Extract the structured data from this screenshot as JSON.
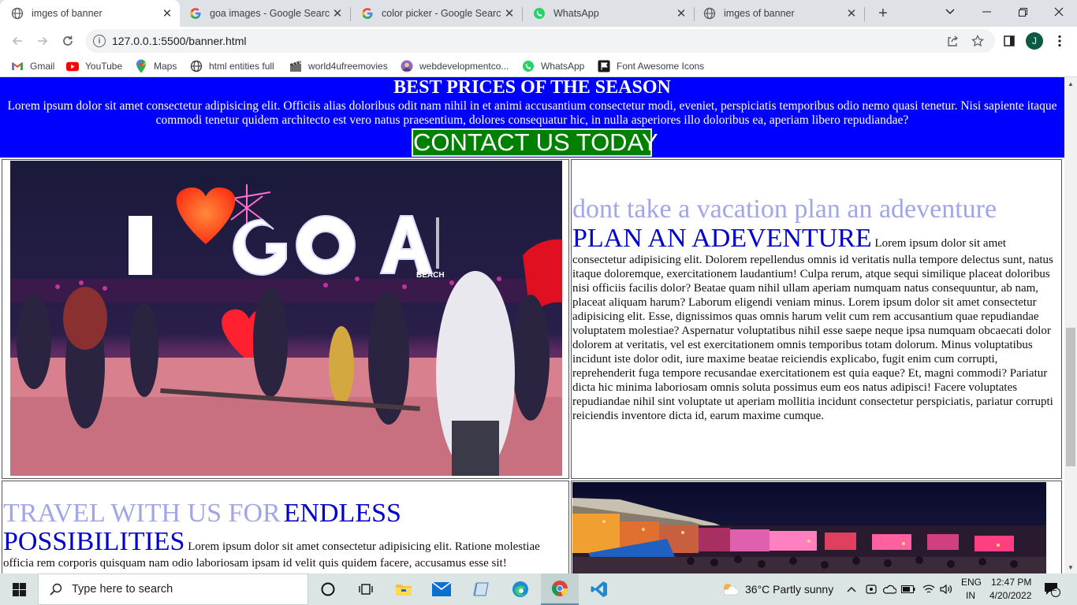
{
  "browser": {
    "tabs": [
      {
        "title": "imges of banner",
        "icon": "globe-icon",
        "active": true
      },
      {
        "title": "goa images - Google Search",
        "icon": "google-icon",
        "active": false
      },
      {
        "title": "color picker - Google Search",
        "icon": "google-icon",
        "active": false
      },
      {
        "title": "WhatsApp",
        "icon": "whatsapp-icon",
        "active": false
      },
      {
        "title": "imges of banner",
        "icon": "globe-icon",
        "active": false
      }
    ],
    "url": "127.0.0.1:5500/banner.html",
    "profile_initial": "J",
    "bookmarks": [
      {
        "label": "Gmail",
        "icon": "gmail-icon"
      },
      {
        "label": "YouTube",
        "icon": "youtube-icon"
      },
      {
        "label": "Maps",
        "icon": "maps-icon"
      },
      {
        "label": "html entities full",
        "icon": "globe-icon"
      },
      {
        "label": "world4ufreemovies",
        "icon": "movie-icon"
      },
      {
        "label": "webdevelopmentco...",
        "icon": "avatar-icon"
      },
      {
        "label": "WhatsApp",
        "icon": "whatsapp-icon"
      },
      {
        "label": "Font Awesome Icons",
        "icon": "flag-icon"
      }
    ]
  },
  "page": {
    "banner": {
      "heading": "BEST PRICES OF THE SEASON",
      "text": "Lorem ipsum dolor sit amet consectetur adipisicing elit. Officiis alias doloribus odit nam nihil in et animi accusantium consectetur modi, eveniet, perspiciatis temporibus odio nemo quasi tenetur. Nisi sapiente itaque commodi tenetur quidem architecto est vero natus praesentium, dolores consequatur hic, in nulla asperiores illo doloribus ea, aperiam libero repudiandae?",
      "button": "CONTACT US TODAY"
    },
    "section1": {
      "subtitle": "dont take a vacation plan an adeventure",
      "title": "PLAN AN ADEVENTURE",
      "text": "Lorem ipsum dolor sit amet consectetur adipisicing elit. Dolorem repellendus omnis id veritatis nulla tempore delectus sunt, natus itaque doloremque, exercitationem laudantium! Culpa rerum, atque sequi similique placeat doloribus nisi officiis facilis dolor? Beatae quam nihil ullam aperiam numquam natus consequuntur, ab nam, placeat aliquam harum? Laborum eligendi veniam minus. Lorem ipsum dolor sit amet consectetur adipisicing elit. Esse, dignissimos quas omnis harum velit cum rem accusantium quae repudiandae voluptatem molestiae? Aspernatur voluptatibus nihil esse saepe neque ipsa numquam obcaecati dolor dolorem at veritatis, vel est exercitationem omnis temporibus totam dolorum. Minus voluptatibus incidunt iste dolor odit, iure maxime beatae reiciendis explicabo, fugit enim cum corrupti, reprehenderit fuga tempore recusandae exercitationem est quia eaque? Et, magni commodi? Pariatur dicta hic minima laboriosam omnis soluta possimus eum eos natus adipisci! Facere voluptates repudiandae nihil sint voluptate ut aperiam mollitia incidunt consectetur perspiciatis, pariatur corrupti reiciendis inventore dicta id, earum maxime cumque."
    },
    "section2": {
      "title_light": "TRAVEL WITH US FOR",
      "title_dark_1": "ENDLESS",
      "title_dark_2": "POSSIBILITIES",
      "text": "Lorem ipsum dolor sit amet consectetur adipisicing elit. Ratione molestiae officia rem corporis quisquam nam odio laboriosam ipsam id velit quis quidem facere, accusamus esse sit!"
    },
    "photo1": {
      "sign_text": "I GOA",
      "sign_small": "BEACH"
    }
  },
  "taskbar": {
    "search_placeholder": "Type here to search",
    "weather": "36°C  Partly sunny",
    "lang_1": "ENG",
    "lang_2": "IN",
    "time": "12:47 PM",
    "date": "4/20/2022",
    "notifications": "2"
  },
  "colors": {
    "banner_bg": "#0000ff",
    "button_bg": "#008000",
    "light_heading": "#a0a6e8",
    "dark_heading": "#0000cc"
  }
}
